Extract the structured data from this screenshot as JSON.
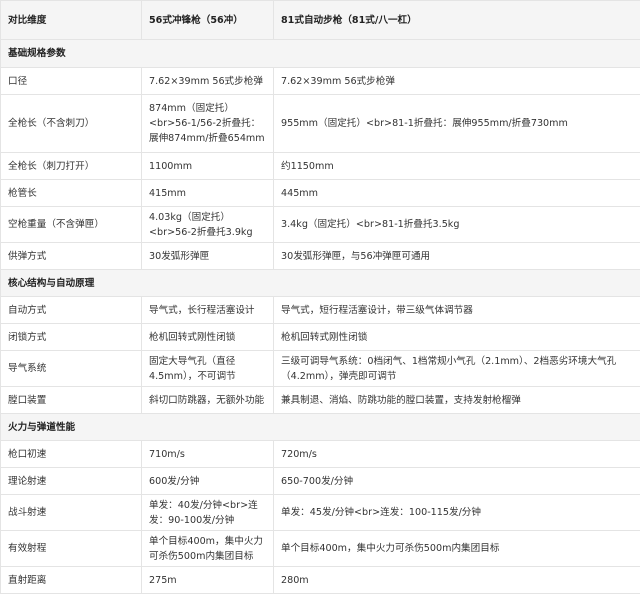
{
  "header": [
    "对比维度",
    "56式冲锋枪（56冲）",
    "81式自动步枪（81式/八一杠）"
  ],
  "rows": [
    {
      "section": true,
      "cells": [
        "基础规格参数"
      ]
    },
    {
      "cells": [
        "口径",
        "7.62×39mm 56式步枪弹",
        "7.62×39mm 56式步枪弹"
      ]
    },
    {
      "cells": [
        "全枪长（不含刺刀）",
        "874mm（固定托）<br>56-1/56-2折叠托：展伸874mm/折叠654mm",
        "955mm（固定托）<br>81-1折叠托：展伸955mm/折叠730mm"
      ]
    },
    {
      "cells": [
        "全枪长（刺刀打开）",
        "1100mm",
        "约1150mm"
      ]
    },
    {
      "cells": [
        "枪管长",
        "415mm",
        "445mm"
      ]
    },
    {
      "cells": [
        "空枪重量（不含弹匣）",
        "4.03kg（固定托）<br>56-2折叠托3.9kg",
        "3.4kg（固定托）<br>81-1折叠托3.5kg"
      ]
    },
    {
      "cells": [
        "供弹方式",
        "30发弧形弹匣",
        "30发弧形弹匣，与56冲弹匣可通用"
      ]
    },
    {
      "section": true,
      "cells": [
        "核心结构与自动原理"
      ]
    },
    {
      "cells": [
        "自动方式",
        "导气式，长行程活塞设计",
        "导气式，短行程活塞设计，带三级气体调节器"
      ]
    },
    {
      "cells": [
        "闭锁方式",
        "枪机回转式刚性闭锁",
        "枪机回转式刚性闭锁"
      ]
    },
    {
      "cells": [
        "导气系统",
        "固定大导气孔（直径4.5mm），不可调节",
        "三级可调导气系统：0档闭气、1档常规小气孔（2.1mm）、2档恶劣环境大气孔（4.2mm），弹壳即可调节"
      ]
    },
    {
      "cells": [
        "膛口装置",
        "斜切口防跳器，无额外功能",
        "兼具制退、消焰、防跳功能的膛口装置，支持发射枪榴弹"
      ]
    },
    {
      "section": true,
      "cells": [
        "火力与弹道性能"
      ]
    },
    {
      "cells": [
        "枪口初速",
        "710m/s",
        "720m/s"
      ]
    },
    {
      "cells": [
        "理论射速",
        "600发/分钟",
        "650-700发/分钟"
      ]
    },
    {
      "cells": [
        "战斗射速",
        "单发：40发/分钟<br>连发：90-100发/分钟",
        "单发：45发/分钟<br>连发：100-115发/分钟"
      ]
    },
    {
      "cells": [
        "有效射程",
        "单个目标400m，集中火力可杀伤500m内集团目标",
        "单个目标400m，集中火力可杀伤500m内集团目标"
      ]
    },
    {
      "cells": [
        "直射距离",
        "275m",
        "280m"
      ]
    }
  ]
}
